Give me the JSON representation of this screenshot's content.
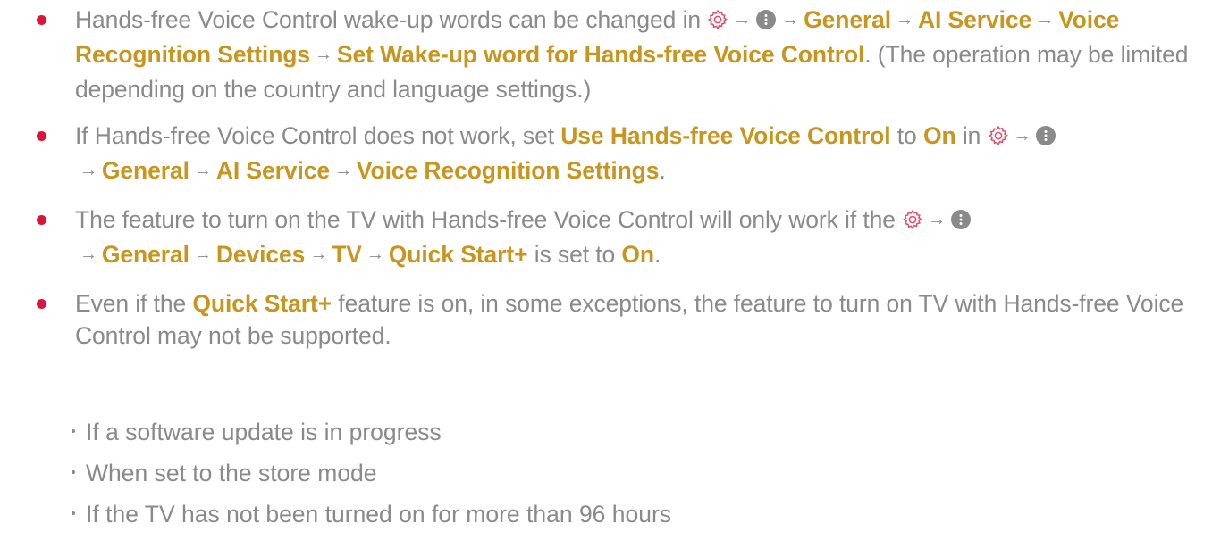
{
  "colors": {
    "accent": "#c8961e",
    "bullet": "#dc143c",
    "text": "#8a8a8a",
    "gear_icon": "#e0536e",
    "more_icon": "#8a8a8a"
  },
  "bullets": [
    {
      "text1": "Hands-free Voice Control wake-up words can be changed in ",
      "path1": "General",
      "path2": "AI Service",
      "path3": "Voice Recognition Settings",
      "path4": "Set Wake-up word for Hands-free Voice Control",
      "text2": ". (The operation may be limited depending on the country and language settings.)"
    },
    {
      "text1": "If Hands-free Voice Control does not work, set ",
      "hl1": "Use Hands-free Voice Control",
      "text2": " to ",
      "hl2": "On",
      "text3": " in ",
      "path1": "General",
      "path2": "AI Service",
      "path3": "Voice Recognition Settings",
      "text4": "."
    },
    {
      "text1": "The feature to turn on the TV with Hands-free Voice Control will only work if the ",
      "path1": "General",
      "path2": "Devices",
      "path3": "TV",
      "path4": "Quick Start+",
      "text2": " is set to ",
      "hl1": "On",
      "text3": "."
    },
    {
      "text1": "Even if the ",
      "hl1": "Quick Start+",
      "text2": " feature is on, in some exceptions, the feature to turn on TV with Hands-free Voice Control may not be supported."
    }
  ],
  "exceptions": [
    "If a software update is in progress",
    "When set to the store mode",
    "If the TV has not been turned on for more than 96 hours"
  ],
  "icons": {
    "settings": "gear-icon",
    "more": "more-icon",
    "arrow": "→"
  }
}
